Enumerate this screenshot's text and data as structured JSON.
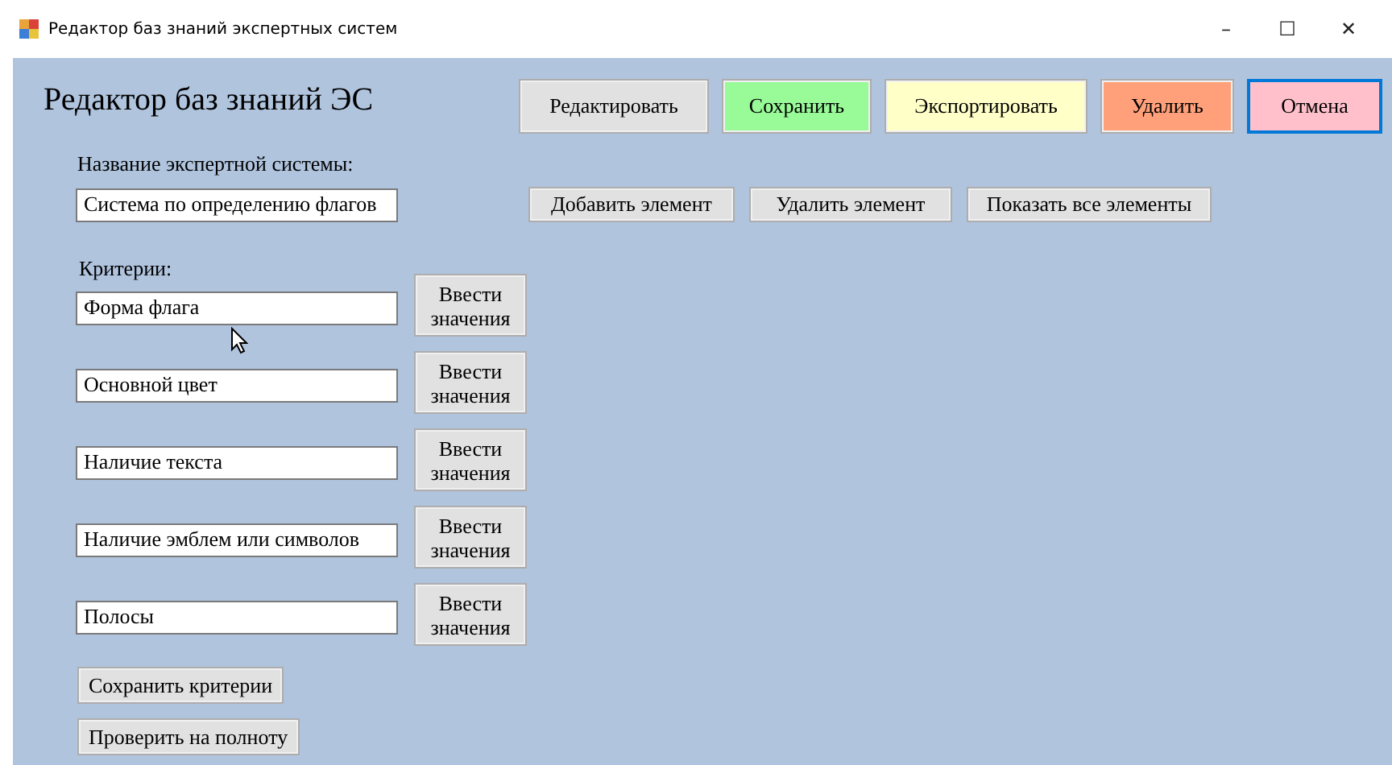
{
  "window": {
    "title": "Редактор баз знаний экспертных систем",
    "controls": [
      "–",
      "☐",
      "✕"
    ]
  },
  "heading": "Редактор баз знаний ЭС",
  "top_buttons": [
    {
      "label": "Редактировать",
      "color": "#e1e1e1",
      "focused": false
    },
    {
      "label": "Сохранить",
      "color": "#98fb98",
      "focused": false
    },
    {
      "label": "Экспортировать",
      "color": "#ffffc8",
      "focused": false
    },
    {
      "label": "Удалить",
      "color": "#ffa07a",
      "focused": false
    },
    {
      "label": "Отмена",
      "color": "#ffc0cb",
      "focused": true
    }
  ],
  "system_name": {
    "label": "Название экспертной системы:",
    "value": "Система по определению флагов"
  },
  "element_buttons": [
    "Добавить элемент",
    "Удалить элемент",
    "Показать все элементы"
  ],
  "criteria": {
    "label": "Критерии:",
    "rows": [
      {
        "value": "Форма флага",
        "button": "Ввести значения"
      },
      {
        "value": "Основной цвет",
        "button": "Ввести значения"
      },
      {
        "value": "Наличие текста",
        "button": "Ввести значения"
      },
      {
        "value": "Наличие эмблем или символов",
        "button": "Ввести значения"
      },
      {
        "value": "Полосы",
        "button": "Ввести значения"
      }
    ]
  },
  "bottom_buttons": [
    "Сохранить критерии",
    "Проверить на полноту"
  ]
}
